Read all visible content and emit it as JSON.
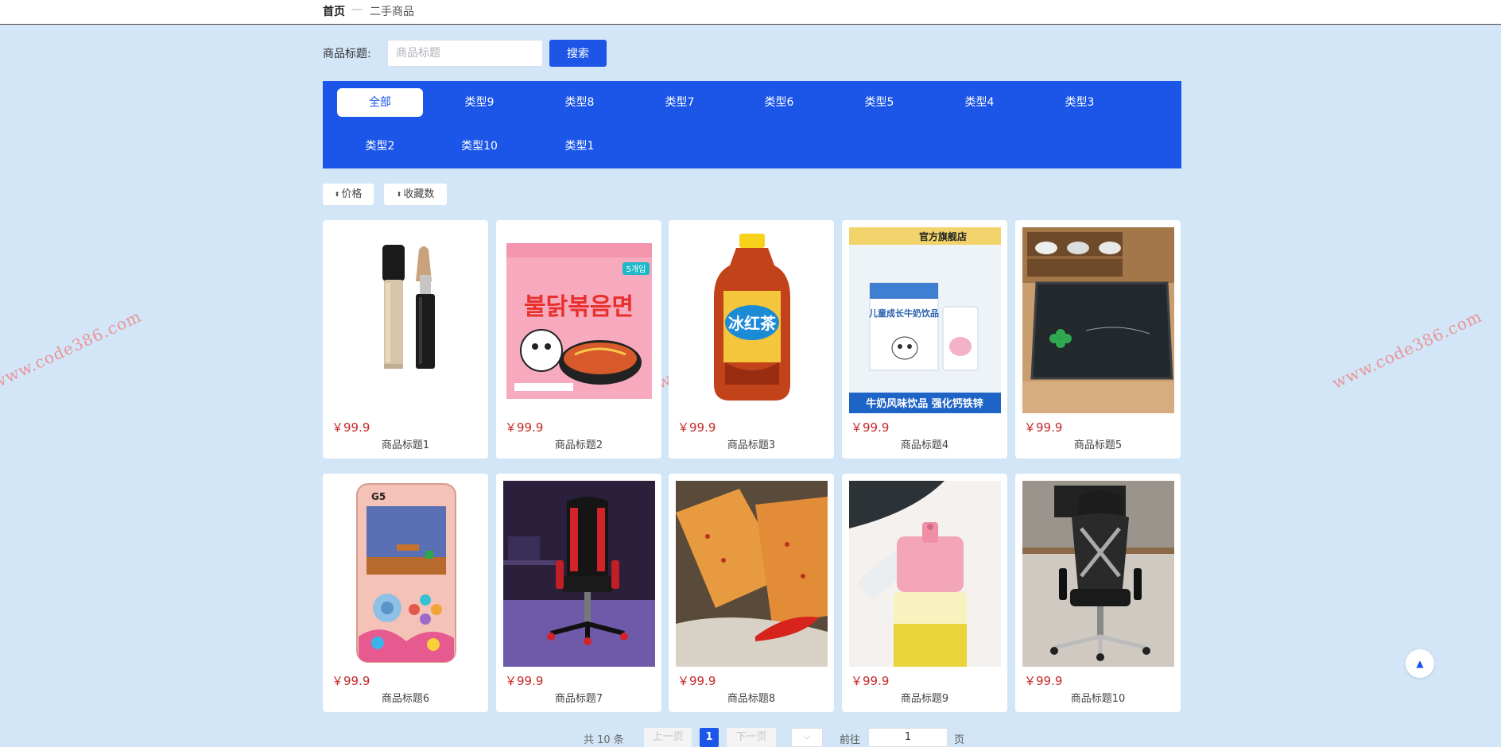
{
  "breadcrumb": {
    "home": "首页",
    "separator": "—",
    "current": "二手商品"
  },
  "search": {
    "label": "商品标题:",
    "placeholder": "商品标题",
    "button": "搜索"
  },
  "categories": [
    "全部",
    "类型9",
    "类型8",
    "类型7",
    "类型6",
    "类型5",
    "类型4",
    "类型3",
    "类型2",
    "类型10",
    "类型1"
  ],
  "active_category": "全部",
  "sort": {
    "price": "价格",
    "favorites": "收藏数",
    "arrow_glyph": "⬍"
  },
  "products": [
    {
      "price": "￥99.9",
      "title": "商品标题1",
      "image": "concealer-image"
    },
    {
      "price": "￥99.9",
      "title": "商品标题2",
      "image": "noodles-pack-image"
    },
    {
      "price": "￥99.9",
      "title": "商品标题3",
      "image": "ice-tea-bottle-image"
    },
    {
      "price": "￥99.9",
      "title": "商品标题4",
      "image": "milk-drink-box-image"
    },
    {
      "price": "￥99.9",
      "title": "商品标题5",
      "image": "doormat-image"
    },
    {
      "price": "￥99.9",
      "title": "商品标题6",
      "image": "handheld-game-console-image"
    },
    {
      "price": "￥99.9",
      "title": "商品标题7",
      "image": "gaming-chair-image"
    },
    {
      "price": "￥99.9",
      "title": "商品标题8",
      "image": "spicy-strip-snack-image"
    },
    {
      "price": "￥99.9",
      "title": "商品标题9",
      "image": "oil-bottle-image"
    },
    {
      "price": "￥99.9",
      "title": "商品标题10",
      "image": "office-chair-image"
    }
  ],
  "product_image_text": {
    "p2_badge": "5개입",
    "p2_name": "불닭볶음면",
    "p3_label": "冰红茶",
    "p4_header": "官方旗舰店",
    "p4_footer": "牛奶风味饮品 强化钙铁锌",
    "p4_box": "儿童成长牛奶饮品",
    "p6_brand": "G5"
  },
  "watermark": "www.code386.com",
  "back_to_top_icon": "▲",
  "pagination": {
    "total": "共 10 条",
    "prev": "上一页",
    "current": "1",
    "next": "下一页",
    "size_icon": "⌵",
    "goto": "前往",
    "goto_value": "1",
    "page_unit": "页"
  },
  "colors": {
    "accent": "#1b56e8",
    "price": "#c62828",
    "background": "#d2e6f7"
  }
}
